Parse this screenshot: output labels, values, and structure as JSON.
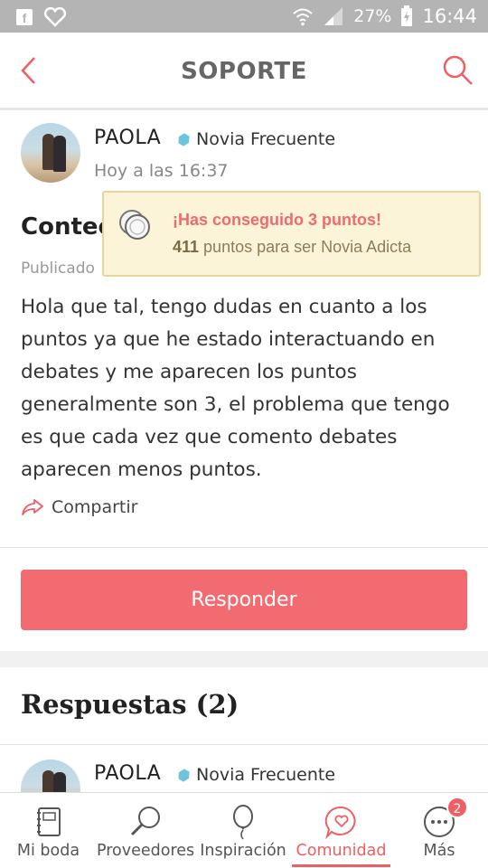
{
  "status_bar": {
    "battery": "27%",
    "time": "16:44"
  },
  "header": {
    "title": "SOPORTE"
  },
  "post": {
    "author": "PAOLA",
    "badge": "Novia Frecuente",
    "timestamp": "Hoy a las 16:37",
    "title_visible": "Conteo",
    "meta_visible": "Publicado",
    "body": "Hola que tal, tengo dudas en cuanto a los puntos ya que he estado interactuando en debates y me aparecen los puntos generalmente son 3, el problema que tengo es que cada vez que comento debates aparecen menos puntos.",
    "share_label": "Compartir"
  },
  "toast": {
    "title": "¡Has conseguido 3 puntos!",
    "points": "411",
    "subtitle_rest": " puntos para ser Novia Adicta"
  },
  "reply_button": "Responder",
  "answers": {
    "title": "Respuestas (2)",
    "first_author": "PAOLA",
    "first_badge": "Novia Frecuente"
  },
  "bottom_nav": {
    "items": [
      {
        "label": "Mi boda",
        "icon": "notebook-icon"
      },
      {
        "label": "Proveedores",
        "icon": "magnifier-icon"
      },
      {
        "label": "Inspiración",
        "icon": "balloon-icon"
      },
      {
        "label": "Comunidad",
        "icon": "chat-heart-icon",
        "active": true
      },
      {
        "label": "Más",
        "icon": "more-icon",
        "badge": "2"
      }
    ]
  },
  "colors": {
    "accent": "#ef5e63",
    "reply_button": "#f26b70",
    "toast_bg": "#fbf4d9",
    "status_bar": "#b4b4b4"
  }
}
